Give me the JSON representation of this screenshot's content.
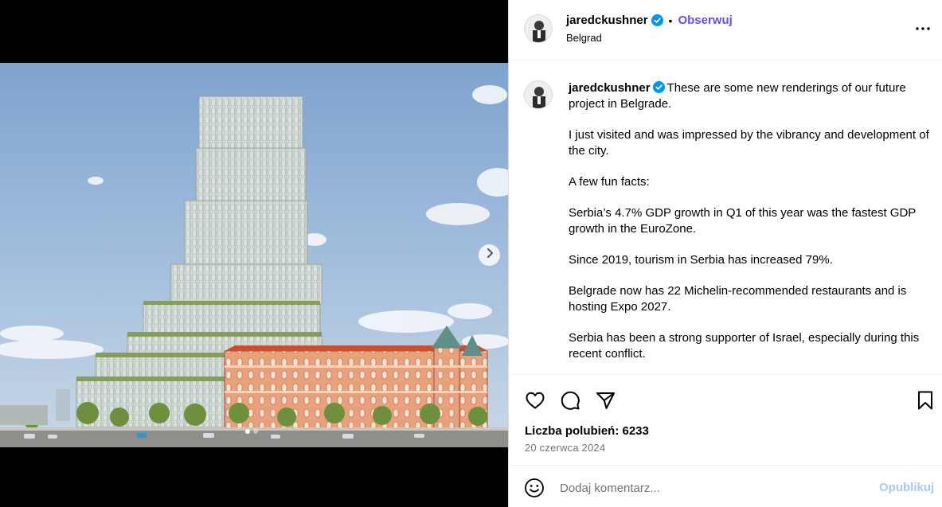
{
  "post": {
    "username": "jaredckushner",
    "follow_label": "Obserwuj",
    "separator": "•",
    "location": "Belgrad",
    "verified_icon": "verified-badge-icon",
    "more_icon": "more-options-icon"
  },
  "caption": {
    "username": "jaredckushner",
    "paragraphs": [
      "These are some new renderings of our future project in Belgrade.",
      "I just visited and was impressed by the vibrancy and development of the city.",
      "A few fun facts:",
      "Serbia’s 4.7% GDP growth in Q1 of this year was the fastest GDP growth in the EuroZone.",
      "Since 2019, tourism in Serbia has increased 79%.",
      "Belgrade now has 22 Michelin-recommended restaurants and is hosting Expo 2027.",
      "Serbia has been a strong supporter of Israel, especially during this recent conflict."
    ]
  },
  "actions": {
    "like_icon": "heart-icon",
    "comment_icon": "comment-icon",
    "share_icon": "share-icon",
    "save_icon": "bookmark-icon",
    "likes_text": "Liczba polubień: 6233",
    "date": "20 czerwca 2024"
  },
  "comment": {
    "placeholder": "Dodaj komentarz...",
    "publish_label": "Opublikuj",
    "emoji_icon": "emoji-icon"
  },
  "media": {
    "slides": 2,
    "active_slide": 1,
    "next_icon": "chevron-right-icon"
  },
  "colors": {
    "follow": "#6a4de8",
    "verified": "#0095f6",
    "publish_disabled": "#a9c8f5",
    "muted": "#737373"
  }
}
